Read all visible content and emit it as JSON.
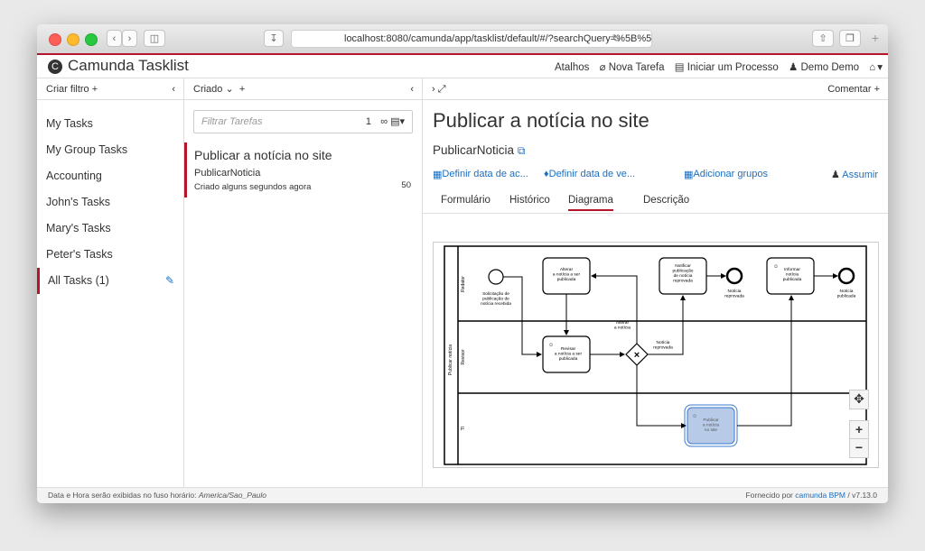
{
  "browser": {
    "url": "localhost:8080/camunda/app/tasklist/default/#/?searchQuery=%5B%5D&filter=",
    "reload_icon": "reload-icon"
  },
  "header": {
    "app_name": "Camunda Tasklist",
    "shortcuts": "Atalhos",
    "new_task": "Nova Tarefa",
    "start_process": "Iniciar um Processo",
    "user": "Demo Demo"
  },
  "filters": {
    "create_label": "Criar filtro +",
    "items": [
      {
        "label": "My Tasks"
      },
      {
        "label": "My Group Tasks"
      },
      {
        "label": "Accounting"
      },
      {
        "label": "John's Tasks"
      },
      {
        "label": "Mary's Tasks"
      },
      {
        "label": "Peter's Tasks"
      },
      {
        "label": "All Tasks (1)"
      }
    ]
  },
  "tasklist": {
    "sort_label": "Criado",
    "search_placeholder": "Filtrar Tarefas",
    "search_count": "1",
    "task": {
      "title": "Publicar  a notícia no site",
      "process": "PublicarNoticia",
      "created": "Criado alguns segundos agora",
      "priority": "50"
    }
  },
  "detail": {
    "comment_label": "Comentar +",
    "title": "Publicar  a notícia no site",
    "process": "PublicarNoticia",
    "actions": {
      "follow_up": "Definir data de ac...",
      "due": "Definir data de ve...",
      "groups": "Adicionar grupos",
      "claim": "Assumir"
    },
    "tabs": [
      "Formulário",
      "Histórico",
      "Diagrama",
      "Descrição"
    ],
    "active_tab": "Diagrama"
  },
  "diagram": {
    "pool": "Publicar notícia",
    "lanes": [
      "Redator",
      "Revisor",
      "TI"
    ],
    "start_event": "Solicitação de publicação de notícia recebida",
    "tasks": {
      "alterar": "Alterar a notícia a ser publicada",
      "notificar": "Notificar publicação de notícia reprovada",
      "informar": "Informar notícia publicada",
      "revisar": "Revisar a notícia a ser publicada",
      "publicar": "Publicar a notícia no site"
    },
    "end_events": {
      "reprovada": "Notícia reprovada",
      "publicada": "Notícia publicada"
    },
    "flows": {
      "alterar": "Alterar a notícia",
      "reprovada": "Notícia reprovada"
    }
  },
  "footer": {
    "timezone_text": "Data e Hora serão exibidas no fuso horário:",
    "timezone": "America/Sao_Paulo",
    "powered": "Fornecido por",
    "vendor": "camunda BPM",
    "version": "/ v7.13.0"
  },
  "colors": {
    "brand_red": "#b5152b",
    "link_blue": "#1a6fc2",
    "highlight_task": "#b7cbe8"
  }
}
